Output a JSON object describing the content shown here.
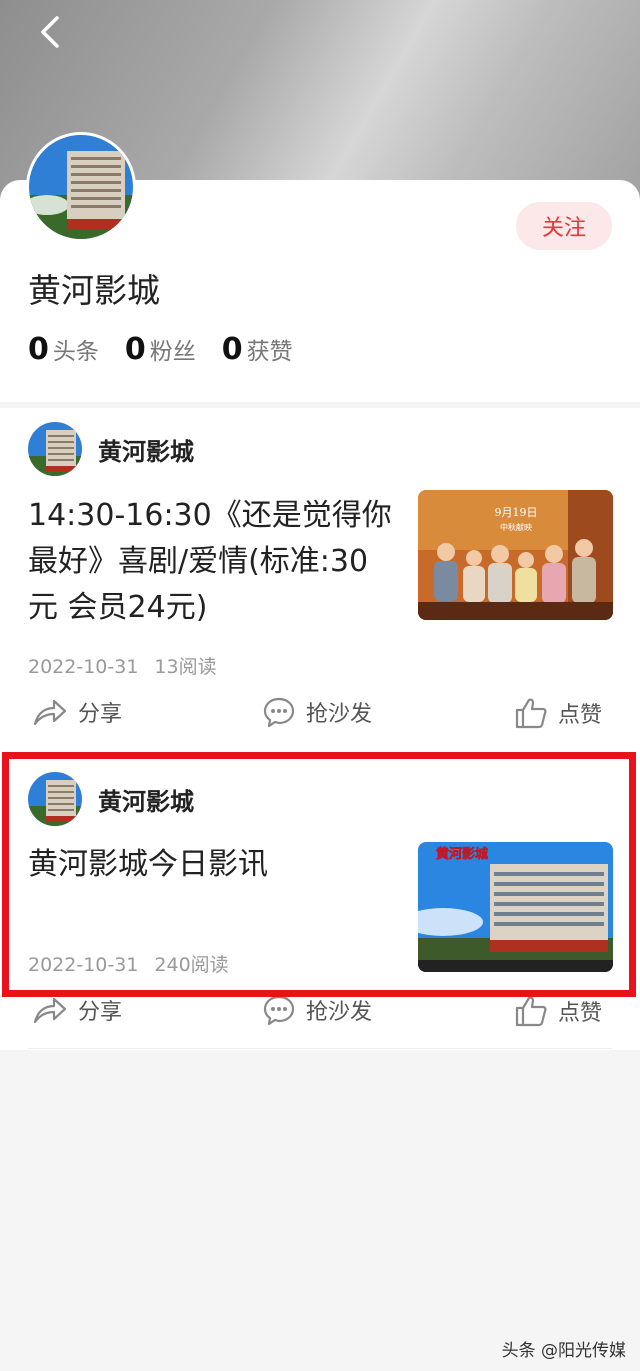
{
  "profile": {
    "name": "黄河影城",
    "follow_label": "关注",
    "stats": [
      {
        "value": "0",
        "label": "头条"
      },
      {
        "value": "0",
        "label": "粉丝"
      },
      {
        "value": "0",
        "label": "获赞"
      }
    ]
  },
  "posts": [
    {
      "author": "黄河影城",
      "title": "14:30-16:30《还是觉得你最好》喜剧/爱情(标准:30元 会员24元)",
      "date": "2022-10-31",
      "reads": "13阅读",
      "thumb_text": "9月19日",
      "thumb_subtext": "中秋献映"
    },
    {
      "author": "黄河影城",
      "title": "黄河影城今日影讯",
      "date": "2022-10-31",
      "reads": "240阅读",
      "thumb_text": "黄河影城"
    }
  ],
  "actions": {
    "share": "分享",
    "comment": "抢沙发",
    "like": "点赞"
  },
  "watermark": "头条 @阳光传媒",
  "colors": {
    "accent": "#e7343f",
    "highlight": "#e8121b"
  }
}
